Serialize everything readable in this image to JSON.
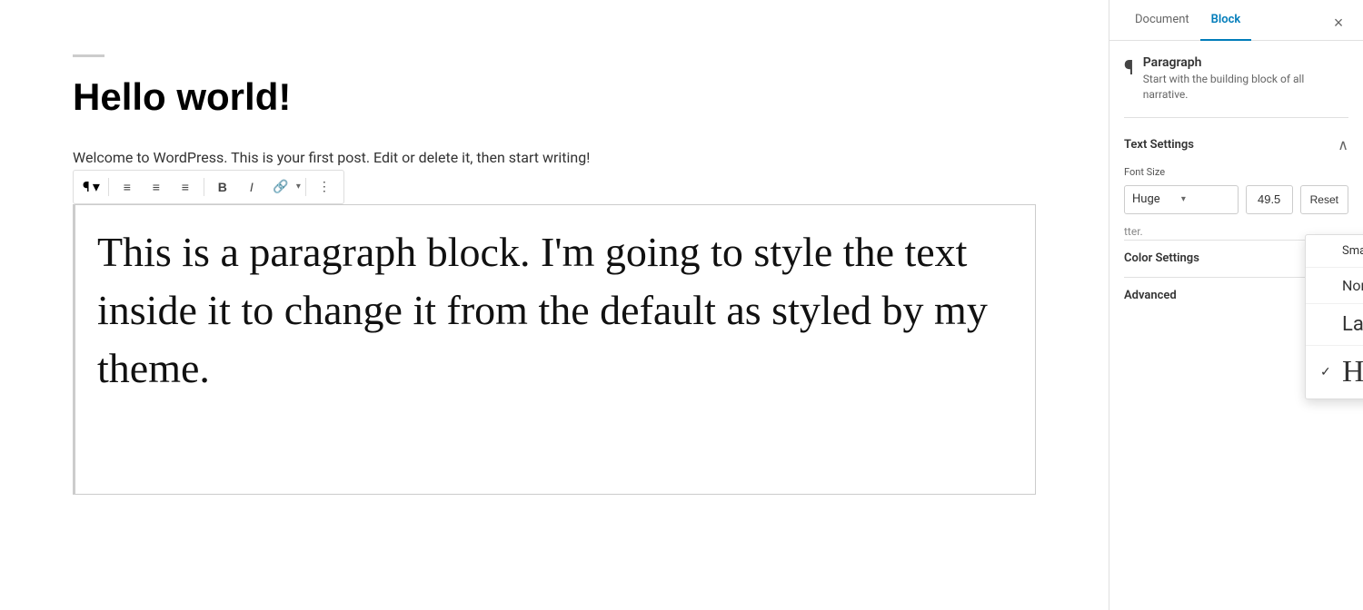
{
  "editor": {
    "title": "Hello world!",
    "welcome_text": "Welcome to WordPress. This is your first post. Edit or delete it, then start writing!",
    "paragraph_content": "This is a paragraph block. I'm going to style the text inside it to change it from the default as styled by my theme."
  },
  "toolbar": {
    "paragraph_btn": "¶",
    "align_left": "≡",
    "align_center": "≡",
    "align_right": "≡",
    "bold": "B",
    "italic": "I",
    "link": "🔗",
    "more_options": "⋮"
  },
  "sidebar": {
    "tab_document": "Document",
    "tab_block": "Block",
    "close_label": "×",
    "block_icon": "¶",
    "block_name": "Paragraph",
    "block_desc": "Start with the building block of all narrative.",
    "text_settings_title": "Text Settings",
    "font_size_label": "Font Size",
    "font_size_value": "49.5",
    "font_size_selected": "Huge",
    "reset_label": "Reset",
    "dropdown_options": [
      {
        "label": "Small",
        "size": "small",
        "selected": false
      },
      {
        "label": "Normal",
        "size": "normal",
        "selected": false
      },
      {
        "label": "Large",
        "size": "large",
        "selected": false
      },
      {
        "label": "Huge",
        "size": "huge",
        "selected": true
      }
    ]
  }
}
